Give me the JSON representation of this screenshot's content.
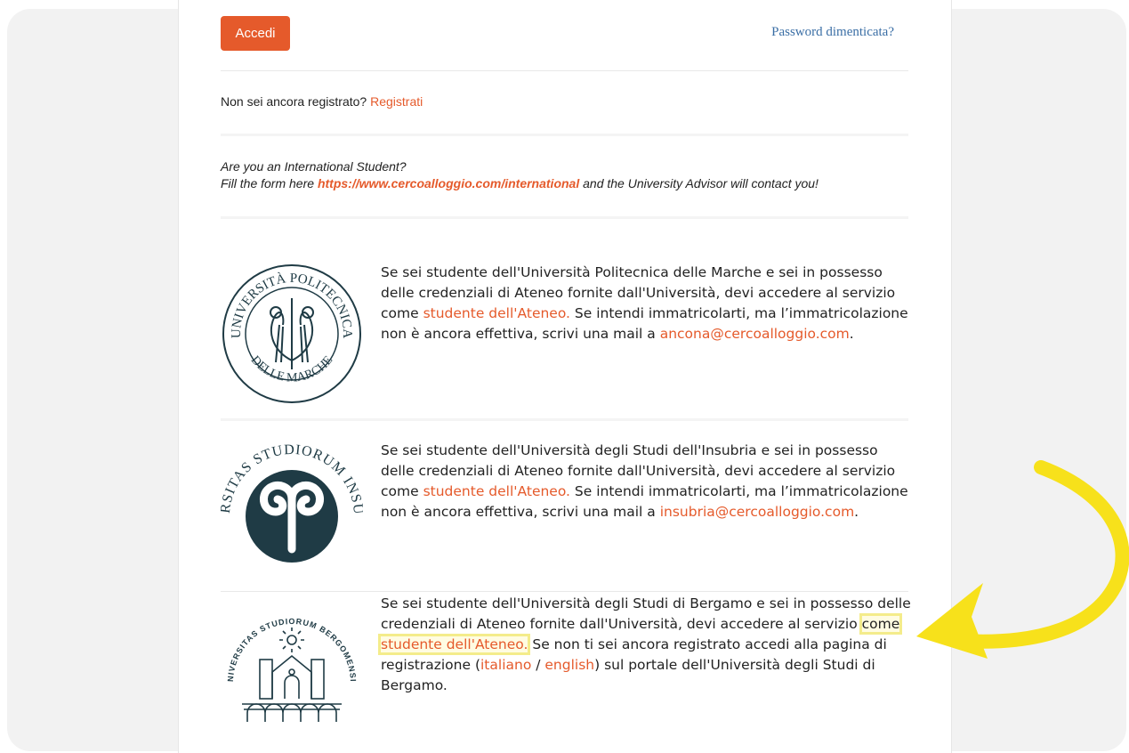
{
  "login": {
    "button_label": "Accedi",
    "forgot_password": "Password dimenticata?"
  },
  "register": {
    "prompt": "Non sei ancora registrato?",
    "link": "Registrati"
  },
  "international": {
    "line1": "Are you an International Student?",
    "line2_prefix": "Fill the form here ",
    "link": "https://www.cercoalloggio.com/international",
    "line2_suffix": " and the University Advisor will contact you!"
  },
  "universities": [
    {
      "logo_icon": "univpm-seal-icon",
      "logo_text_top": "UNIVERSITÀ POLITECNICA",
      "logo_text_bottom": "DELLE MARCHE",
      "t1": "Se sei studente dell'Università Politecnica delle Marche e sei in possesso delle credenziali di Ateneo fornite dall'Università, devi accedere al servizio come ",
      "link": "studente dell'Ateneo.",
      "t2": " Se intendi immatricolarti, ma l’immatricolazione non è ancora effettiva, scrivi una mail a ",
      "email": "ancona@cercoalloggio.com",
      "t3": "."
    },
    {
      "logo_icon": "insubria-seal-icon",
      "logo_text_top": "UNIVERSITAS STUDIORUM INSUBRIAE",
      "t1": "Se sei studente dell'Università degli Studi dell'Insubria e sei in possesso delle credenziali di Ateneo fornite dall'Università, devi accedere al servizio come ",
      "link": "studente dell'Ateneo.",
      "t2": " Se intendi immatricolarti, ma l’immatricolazione non è ancora effettiva, scrivi una mail a ",
      "email": "insubria@cercoalloggio.com",
      "t3": "."
    },
    {
      "logo_icon": "bergamo-seal-icon",
      "logo_text_top": "UNIVERSITAS STUDIORUM BERGOMENSIS",
      "t1": "Se sei studente dell'Università degli Studi di Bergamo e sei in possesso delle credenziali di Ateneo fornite dall'Università, devi accedere al servizio ",
      "highlight_pre": "come ",
      "link": "studente dell'Ateneo.",
      "t2": " Se non ti sei ancora registrato accedi alla pagina di registrazione (",
      "lang_it": "italiano",
      "slash": " / ",
      "lang_en": "english",
      "t3": ") sul portale dell'Università degli Studi di Bergamo."
    }
  ],
  "colors": {
    "accent": "#e55a2b",
    "link_blue": "#3a6ea5",
    "arrow_yellow": "#f7e11b",
    "seal_dark": "#1f3b45"
  }
}
